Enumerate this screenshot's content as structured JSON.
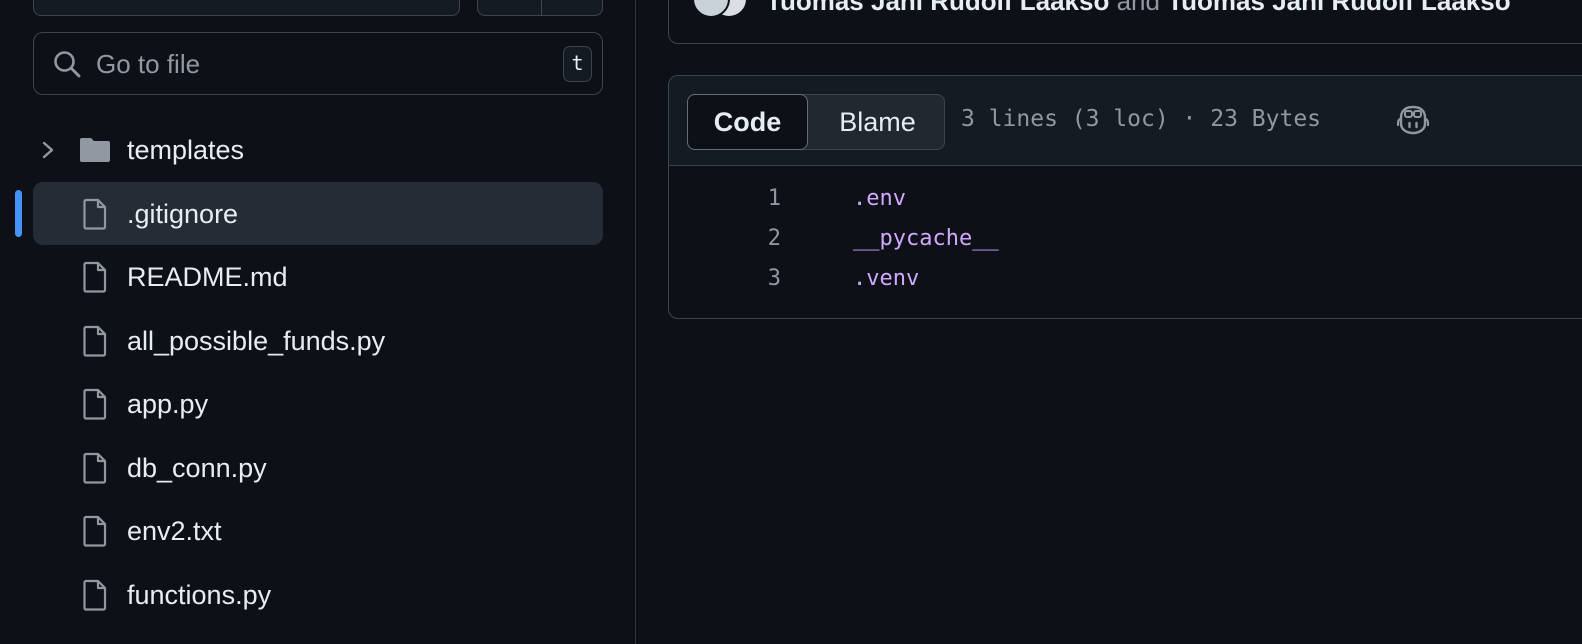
{
  "search": {
    "placeholder": "Go to file",
    "shortcut": "t"
  },
  "tree": [
    {
      "label": "templates",
      "type": "folder",
      "selected": false
    },
    {
      "label": ".gitignore",
      "type": "file",
      "selected": true
    },
    {
      "label": "README.md",
      "type": "file",
      "selected": false
    },
    {
      "label": "all_possible_funds.py",
      "type": "file",
      "selected": false
    },
    {
      "label": "app.py",
      "type": "file",
      "selected": false
    },
    {
      "label": "db_conn.py",
      "type": "file",
      "selected": false
    },
    {
      "label": "env2.txt",
      "type": "file",
      "selected": false
    },
    {
      "label": "functions.py",
      "type": "file",
      "selected": false
    }
  ],
  "commit": {
    "author1": "Tuomas Jani Rudolf Laakso",
    "joiner": "and",
    "author2": "Tuomas Jani Rudolf Laakso"
  },
  "file": {
    "tabs": {
      "code": "Code",
      "blame": "Blame"
    },
    "meta": "3 lines (3 loc) · 23 Bytes",
    "lines": [
      {
        "num": "1",
        "text": ".env"
      },
      {
        "num": "2",
        "text": "__pycache__"
      },
      {
        "num": "3",
        "text": ".venv"
      }
    ]
  },
  "colors": {
    "background": "#0d1117",
    "accent": "#4493f8",
    "code_text": "#d2a8ff",
    "selected_row": "#262c36"
  }
}
